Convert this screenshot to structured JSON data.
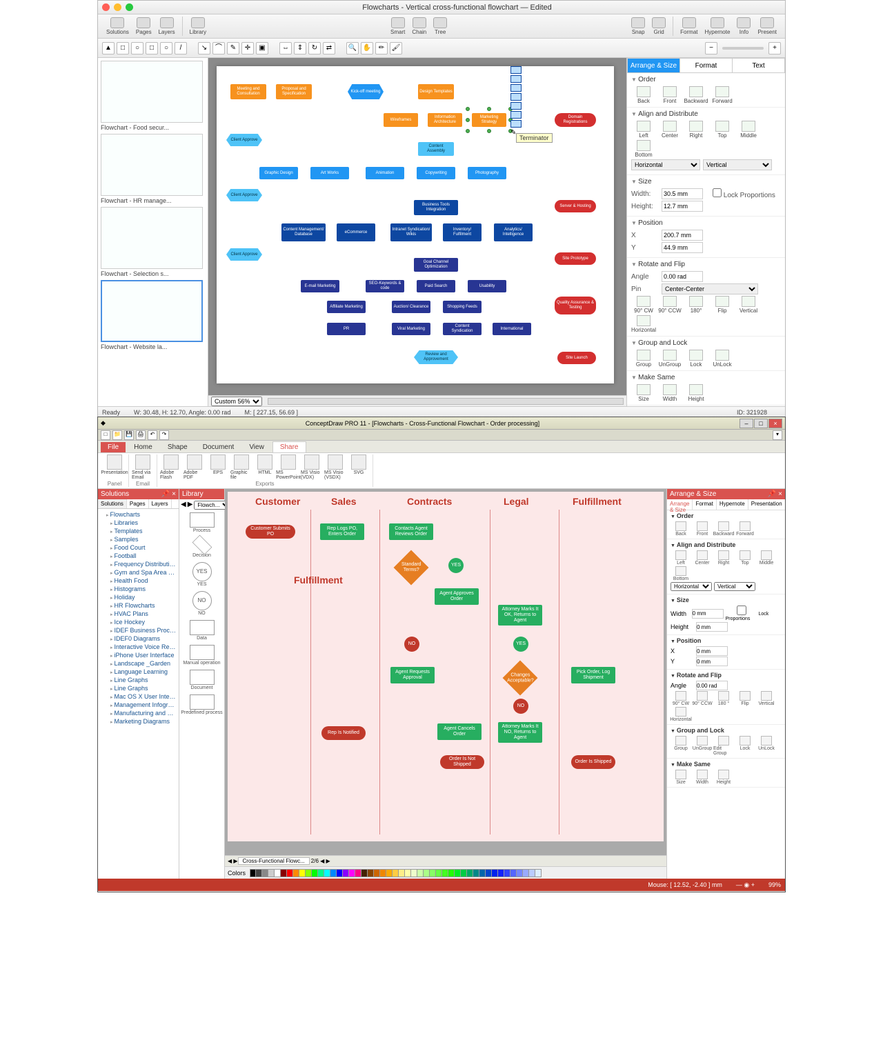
{
  "app1": {
    "title": "Flowcharts - Vertical cross-functional flowchart — Edited",
    "toolbar": [
      "Solutions",
      "Pages",
      "Layers",
      "Library",
      "Smart",
      "Chain",
      "Tree",
      "Snap",
      "Grid",
      "Format",
      "Hypernote",
      "Info",
      "Present"
    ],
    "thumbs": [
      {
        "cap": "Flowchart - Food secur..."
      },
      {
        "cap": "Flowchart - HR manage..."
      },
      {
        "cap": "Flowchart - Selection s..."
      },
      {
        "cap": "Flowchart - Website la...",
        "selected": true
      }
    ],
    "shapes": {
      "meeting": "Meeting and Consultation",
      "proposal": "Proposal and Specification",
      "kickoff": "Kick-off meeting",
      "design": "Design Templates",
      "wireframes": "Wireframes",
      "info": "Information Architecture",
      "marketing": "Marketing Strategy",
      "domain": "Domain Registrations",
      "approve": "Client Approve",
      "content": "Content Assembly",
      "graphic": "Graphic Design",
      "art": "Art Works",
      "anim": "Animation",
      "copy": "Copywriting",
      "photo": "Photography",
      "biztools": "Business Tools Integration",
      "server": "Server & Hosting",
      "cms": "Content Management/ Database",
      "ecom": "eCommerce",
      "intranet": "Intranet Syndication/ Wikis",
      "inventory": "Inventory/ Fulfilment",
      "analytics": "Analytics/ Intelligence",
      "siteproto": "Site Prototype",
      "goal": "Goal Channel Optimization",
      "email": "E-mail Marketing",
      "seo": "SEO-Keywords & code",
      "paid": "Paid Search",
      "usab": "Usability",
      "affiliate": "Affiliate Marketing",
      "auction": "Auction/ Clearance",
      "shopping": "Shopping Feeds",
      "qa": "Quality Assurance & Testing",
      "pr": "PR",
      "viral": "Viral Marketing",
      "syndic": "Content Syndication",
      "intl": "International",
      "review": "Review and Approvement",
      "launch": "Site Launch"
    },
    "tooltip": "Terminator",
    "zoom": "Custom 56%",
    "inspector": {
      "tabs": [
        "Arrange & Size",
        "Format",
        "Text"
      ],
      "order": {
        "hd": "Order",
        "btns": [
          "Back",
          "Front",
          "Backward",
          "Forward"
        ]
      },
      "align": {
        "hd": "Align and Distribute",
        "btns": [
          "Left",
          "Center",
          "Right",
          "Top",
          "Middle",
          "Bottom"
        ],
        "h": "Horizontal",
        "v": "Vertical"
      },
      "size": {
        "hd": "Size",
        "width_l": "Width:",
        "width": "30.5 mm",
        "height_l": "Height:",
        "height": "12.7 mm",
        "lock": "Lock Proportions"
      },
      "pos": {
        "hd": "Position",
        "x_l": "X",
        "x": "200.7 mm",
        "y_l": "Y",
        "y": "44.9 mm"
      },
      "rot": {
        "hd": "Rotate and Flip",
        "angle_l": "Angle",
        "angle": "0.00 rad",
        "pin_l": "Pin",
        "pin": "Center-Center",
        "btns": [
          "90° CW",
          "90° CCW",
          "180°",
          "Flip",
          "Vertical",
          "Horizontal"
        ]
      },
      "group": {
        "hd": "Group and Lock",
        "btns": [
          "Group",
          "UnGroup",
          "Lock",
          "UnLock"
        ]
      },
      "same": {
        "hd": "Make Same",
        "btns": [
          "Size",
          "Width",
          "Height"
        ]
      }
    },
    "status": {
      "ready": "Ready",
      "dims": "W: 30.48,  H: 12.70,  Angle: 0.00 rad",
      "mouse": "M: [ 227.15, 56.69 ]",
      "id": "ID: 321928"
    }
  },
  "app2": {
    "title": "ConceptDraw PRO 11 - [Flowcharts - Cross-Functional Flowchart - Order processing]",
    "ribtabs": [
      "File",
      "Home",
      "Shape",
      "Document",
      "View",
      "Share"
    ],
    "ribbon": {
      "panel": {
        "lbl": "Panel",
        "items": [
          "Presentation"
        ]
      },
      "email": {
        "lbl": "Email",
        "items": [
          "Send via Email"
        ]
      },
      "exports": {
        "lbl": "Exports",
        "items": [
          "Adobe Flash",
          "Adobe PDF",
          "EPS",
          "Graphic file",
          "HTML",
          "MS PowerPoint",
          "MS Visio (VDX)",
          "MS Visio (VSDX)",
          "SVG"
        ]
      }
    },
    "solutions": {
      "hd": "Solutions",
      "tabs": [
        "Solutions",
        "Pages",
        "Layers"
      ],
      "tree": [
        "Flowcharts",
        "Libraries",
        "Templates",
        "Samples",
        "Food Court",
        "Football",
        "Frequency Distribution Dashboard",
        "Gym and Spa Area Plans",
        "Health Food",
        "Histograms",
        "Holiday",
        "HR Flowcharts",
        "HVAC Plans",
        "Ice Hockey",
        "IDEF Business Process Diagrams",
        "IDEF0 Diagrams",
        "Interactive Voice Response Diagrams",
        "iPhone User Interface",
        "Landscape _Garden",
        "Language Learning",
        "Line Graphs",
        "Line Graphs",
        "Mac OS X User Interface",
        "Management Infographics",
        "Manufacturing and Maintenance",
        "Marketing Diagrams"
      ]
    },
    "library": {
      "hd": "Library",
      "dd": "Flowch...",
      "items": [
        "Process",
        "Decision",
        "YES",
        "NO",
        "Data",
        "Manual operation",
        "Document",
        "Predefined process"
      ]
    },
    "lanes": [
      "Customer",
      "Sales",
      "Contracts",
      "Legal",
      "Fulfillment"
    ],
    "fshapes": {
      "submit": "Customer Submits PO",
      "rep": "Rep Logs PO, Enters Order",
      "contacts": "Contacts Agent Reviews Order",
      "stdterms": "Standard Terms?",
      "yes1": "YES",
      "approves": "Agent Approves Order",
      "attok": "Attorney Marks It OK, Returns to Agent",
      "yes2": "YES",
      "no1": "NO",
      "requests": "Agent Requests Approval",
      "changes": "Changes Acceptable?",
      "pick": "Pick Order, Log Shipment",
      "no2": "NO",
      "notified": "Rep Is Notified",
      "cancels": "Agent Cancels Order",
      "attno": "Attorney Marks It NO, Returns to Agent",
      "notshipped": "Order Is Not Shipped",
      "shipped": "Order Is Shipped",
      "fulfill": "Fulfillment"
    },
    "doctab": "Cross-Functional Flowc...",
    "colors_l": "Colors",
    "inspector2": {
      "hd": "Arrange & Size",
      "tabs": [
        "Arrange & Size",
        "Format",
        "Hypernote",
        "Presentation"
      ],
      "order": {
        "hd": "Order",
        "btns": [
          "Back",
          "Front",
          "Backward",
          "Forward"
        ]
      },
      "align": {
        "hd": "Align and Distribute",
        "btns": [
          "Left",
          "Center",
          "Right",
          "Top",
          "Middle",
          "Bottom"
        ],
        "h": "Horizontal",
        "v": "Vertical"
      },
      "size": {
        "hd": "Size",
        "width_l": "Width",
        "width": "0 mm",
        "height_l": "Height",
        "height": "0 mm",
        "lock": "Lock Proportions"
      },
      "pos": {
        "hd": "Position",
        "x_l": "X",
        "x": "0 mm",
        "y_l": "Y",
        "y": "0 mm"
      },
      "rot": {
        "hd": "Rotate and Flip",
        "angle_l": "Angle",
        "angle": "0.00 rad",
        "btns": [
          "90° CW",
          "90° CCW",
          "180 °",
          "Flip",
          "Vertical",
          "Horizontal"
        ]
      },
      "group": {
        "hd": "Group and Lock",
        "btns": [
          "Group",
          "UnGroup",
          "Edit Group",
          "Lock",
          "UnLock"
        ]
      },
      "same": {
        "hd": "Make Same",
        "btns": [
          "Size",
          "Width",
          "Height"
        ]
      }
    },
    "status": {
      "mouse": "Mouse: [ 12.52, -2.40 ] mm",
      "zoom": "99%"
    }
  }
}
